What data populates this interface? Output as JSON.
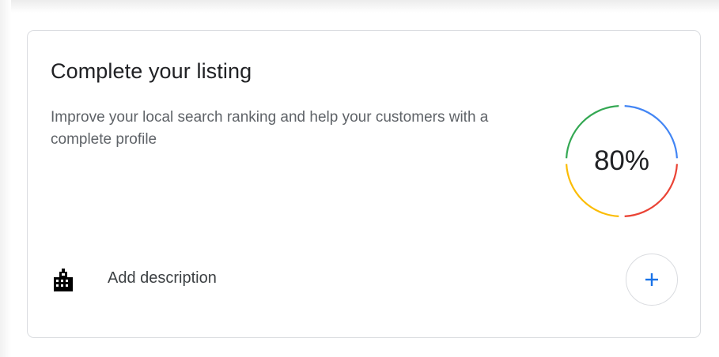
{
  "card": {
    "title": "Complete your listing",
    "subtitle": "Improve your local search ranking and help your customers with a complete profile",
    "progress": {
      "value": 80,
      "label": "80%",
      "segment_colors": [
        "#4285f4",
        "#ea4335",
        "#fbbc04",
        "#34a853"
      ]
    },
    "task": {
      "icon": "building-icon",
      "label": "Add description",
      "action_icon": "plus-icon",
      "accent": "#1a73e8"
    }
  }
}
